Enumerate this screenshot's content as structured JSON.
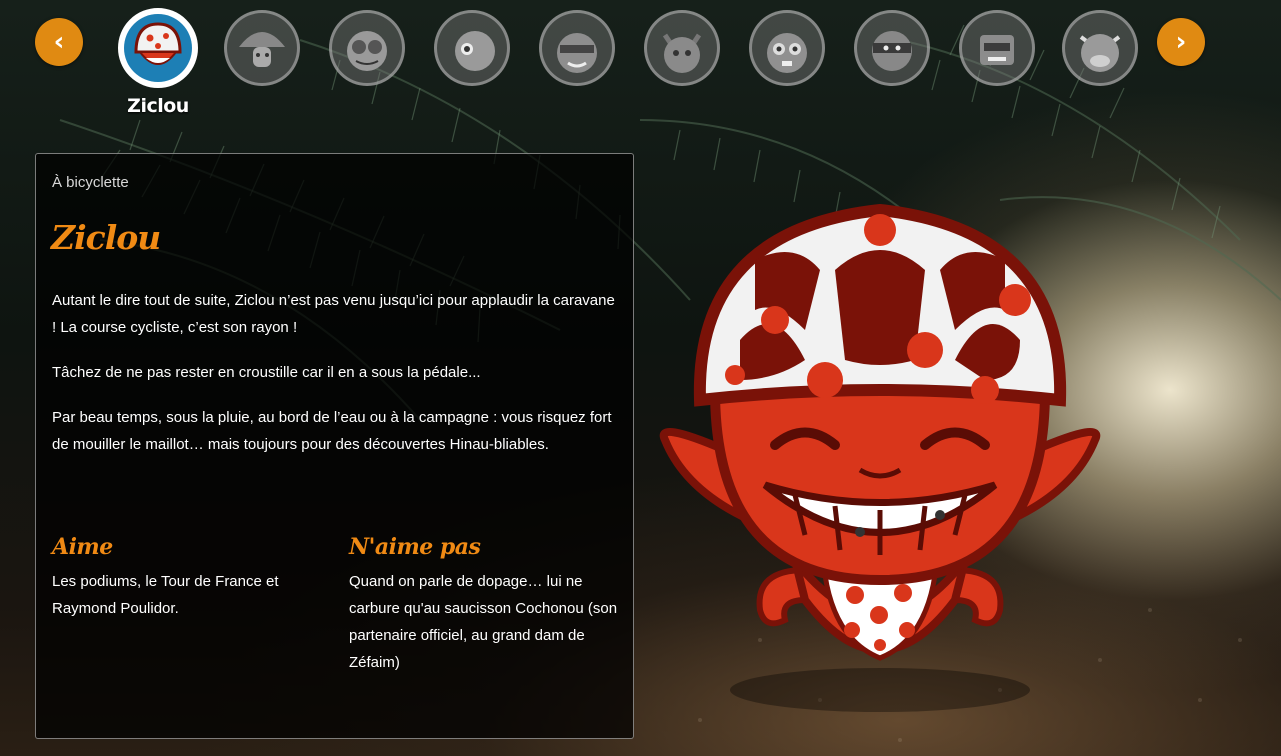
{
  "carousel": {
    "prev_label": "‹",
    "next_label": "›",
    "active_name": "Ziclou",
    "thumbnails": [
      "ziclou",
      "character-2",
      "character-3",
      "character-4",
      "character-5",
      "character-6",
      "character-7",
      "character-8",
      "character-9",
      "character-10"
    ]
  },
  "panel": {
    "breadcrumb": "À bicyclette",
    "title": "Ziclou",
    "paragraphs": [
      "Autant le dire tout de suite, Ziclou n’est pas venu jusqu’ici pour applaudir la caravane ! La course cycliste, c’est son rayon !",
      "Tâchez de ne pas rester en croustille car il en a sous la pédale...",
      "Par beau temps, sous la pluie, au bord de l’eau ou à la campagne : vous risquez fort de mouiller le maillot… mais toujours pour des découvertes Hinau-bliables."
    ],
    "likes": {
      "heading": "Aime",
      "text": "Les podiums, le Tour de France et Raymond Poulidor."
    },
    "dislikes": {
      "heading": "N'aime pas",
      "text": "Quand on parle de dopage… lui ne carbure qu'au saucisson Cochonou (son partenaire officiel, au grand dam de Zéfaim)"
    }
  },
  "colors": {
    "accent": "#f08a14",
    "arrow": "#e08a12",
    "character_red": "#d9361b",
    "character_dark": "#7a1208"
  }
}
